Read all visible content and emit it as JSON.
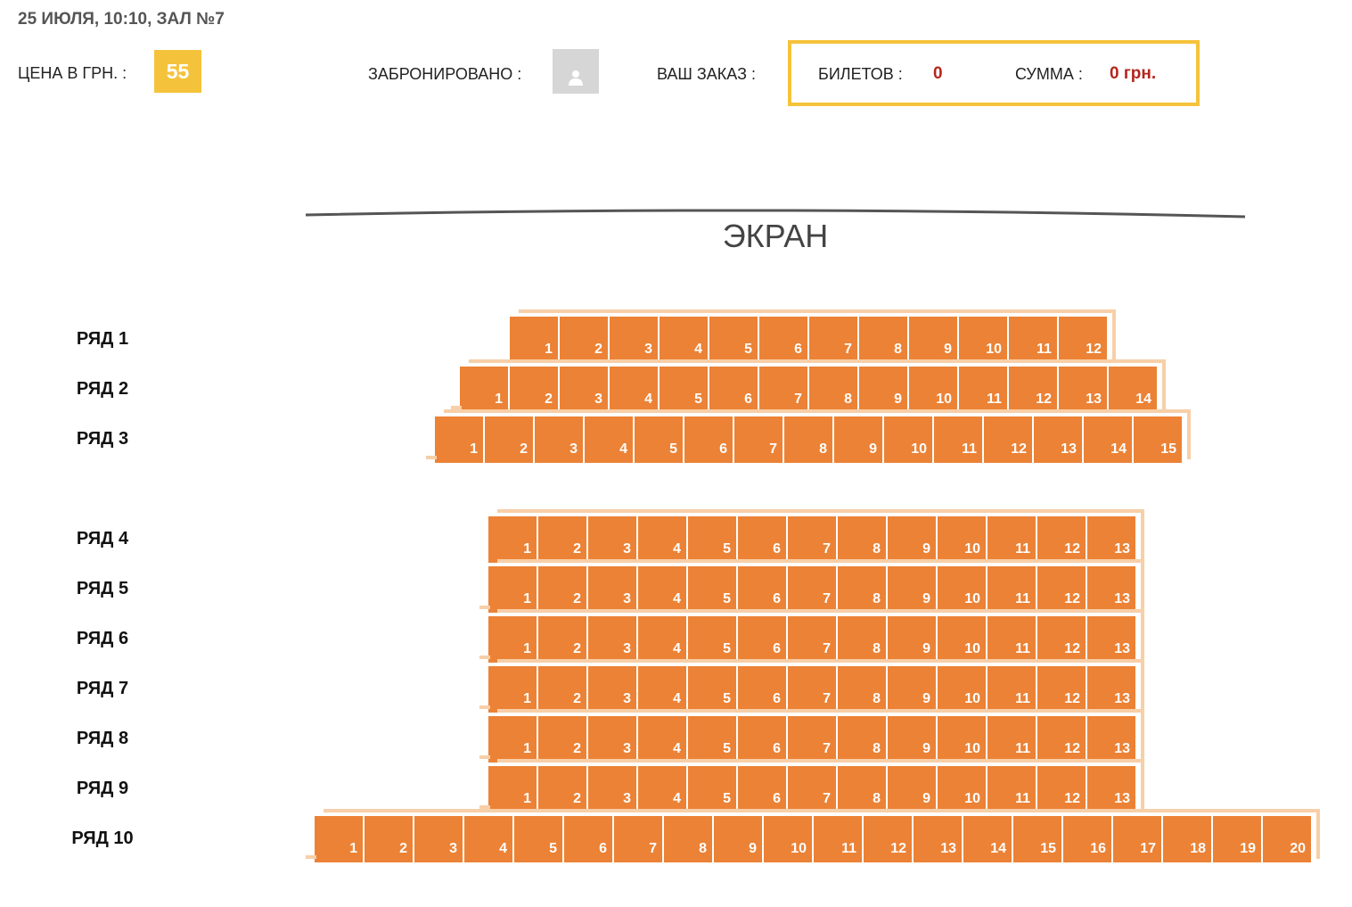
{
  "session": {
    "info": "25 ИЮЛЯ, 10:10, ЗАЛ №7"
  },
  "price": {
    "label": "ЦЕНА В ГРН. :",
    "value": "55"
  },
  "legend": {
    "reserved_label": "ЗАБРОНИРОВАНО :",
    "reserved_icon": "person-icon"
  },
  "order": {
    "label": "ВАШ ЗАКАЗ :",
    "tickets_label": "БИЛЕТОВ :",
    "tickets_value": "0",
    "sum_label": "СУММА :",
    "sum_value": "0 грн."
  },
  "screen": {
    "label": "ЭКРАН"
  },
  "colors": {
    "accent": "#f5c33b",
    "seat_free": "#ec8235",
    "seat_shadow": "#f7cfa8",
    "reserved": "#d6d6d6",
    "order_value": "#b3261e"
  },
  "rows": [
    {
      "label": "РЯД 1",
      "seats": [
        "1",
        "2",
        "3",
        "4",
        "5",
        "6",
        "7",
        "8",
        "9",
        "10",
        "11",
        "12"
      ]
    },
    {
      "label": "РЯД 2",
      "seats": [
        "1",
        "2",
        "3",
        "4",
        "5",
        "6",
        "7",
        "8",
        "9",
        "10",
        "11",
        "12",
        "13",
        "14"
      ]
    },
    {
      "label": "РЯД 3",
      "seats": [
        "1",
        "2",
        "3",
        "4",
        "5",
        "6",
        "7",
        "8",
        "9",
        "10",
        "11",
        "12",
        "13",
        "14",
        "15"
      ]
    },
    {
      "label": "РЯД 4",
      "seats": [
        "1",
        "2",
        "3",
        "4",
        "5",
        "6",
        "7",
        "8",
        "9",
        "10",
        "11",
        "12",
        "13"
      ]
    },
    {
      "label": "РЯД 5",
      "seats": [
        "1",
        "2",
        "3",
        "4",
        "5",
        "6",
        "7",
        "8",
        "9",
        "10",
        "11",
        "12",
        "13"
      ]
    },
    {
      "label": "РЯД 6",
      "seats": [
        "1",
        "2",
        "3",
        "4",
        "5",
        "6",
        "7",
        "8",
        "9",
        "10",
        "11",
        "12",
        "13"
      ]
    },
    {
      "label": "РЯД 7",
      "seats": [
        "1",
        "2",
        "3",
        "4",
        "5",
        "6",
        "7",
        "8",
        "9",
        "10",
        "11",
        "12",
        "13"
      ]
    },
    {
      "label": "РЯД 8",
      "seats": [
        "1",
        "2",
        "3",
        "4",
        "5",
        "6",
        "7",
        "8",
        "9",
        "10",
        "11",
        "12",
        "13"
      ]
    },
    {
      "label": "РЯД 9",
      "seats": [
        "1",
        "2",
        "3",
        "4",
        "5",
        "6",
        "7",
        "8",
        "9",
        "10",
        "11",
        "12",
        "13"
      ]
    },
    {
      "label": "РЯД 10",
      "seats": [
        "1",
        "2",
        "3",
        "4",
        "5",
        "6",
        "7",
        "8",
        "9",
        "10",
        "11",
        "12",
        "13",
        "14",
        "15",
        "16",
        "17",
        "18",
        "19",
        "20"
      ]
    }
  ]
}
